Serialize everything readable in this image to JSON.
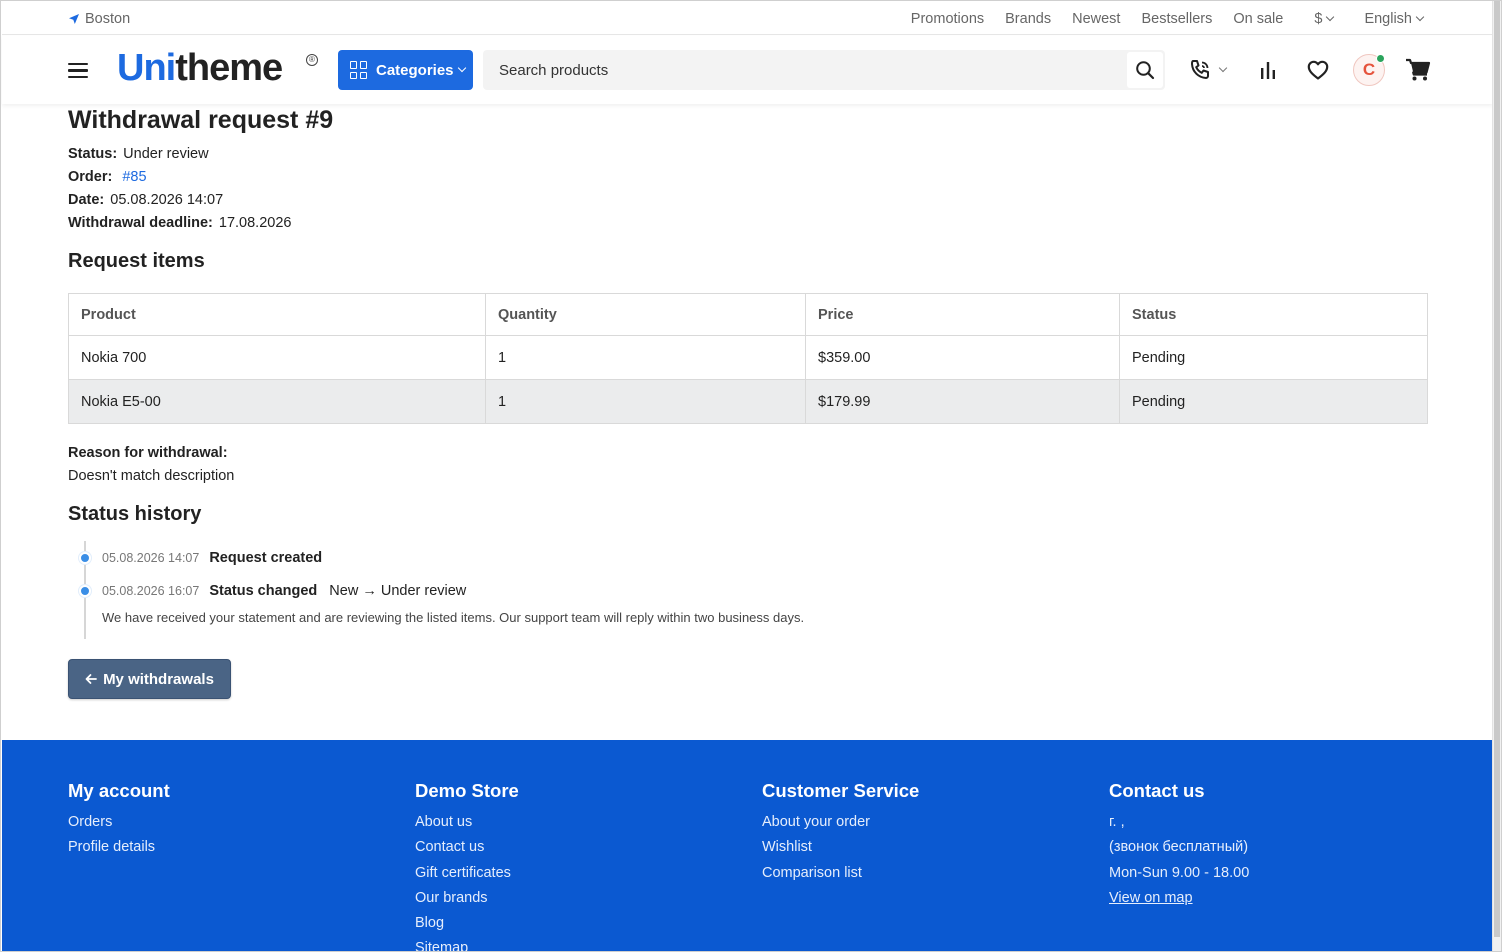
{
  "topbar": {
    "location": "Boston",
    "nav": [
      "Promotions",
      "Brands",
      "Newest",
      "Bestsellers",
      "On sale"
    ],
    "currency": "$",
    "language": "English"
  },
  "header": {
    "logo_part1": "Uni",
    "logo_part2": "theme",
    "logo_mark": "®",
    "categories_label": "Categories",
    "search_placeholder": "Search products",
    "avatar_initial": "C"
  },
  "request": {
    "title": "Withdrawal request #9",
    "status_label": "Status:",
    "status_value": "Under review",
    "order_label": "Order:",
    "order_value": "#85",
    "date_label": "Date:",
    "date_value": "05.08.2026 14:07",
    "deadline_label": "Withdrawal deadline:",
    "deadline_value": "17.08.2026"
  },
  "items": {
    "heading": "Request items",
    "columns": [
      "Product",
      "Quantity",
      "Price",
      "Status"
    ],
    "rows": [
      [
        "Nokia 700",
        "1",
        "$359.00",
        "Pending"
      ],
      [
        "Nokia E5-00",
        "1",
        "$179.99",
        "Pending"
      ]
    ]
  },
  "reason": {
    "label": "Reason for withdrawal:",
    "text": "Doesn't match description"
  },
  "history": {
    "heading": "Status history",
    "entries": [
      {
        "date": "05.08.2026 14:07",
        "event": "Request created",
        "change": ""
      },
      {
        "date": "05.08.2026 16:07",
        "event": "Status changed",
        "change": "New → Under review"
      }
    ],
    "comment": "We have received your statement and are reviewing the listed items. Our support team will reply within two business days."
  },
  "back_button": {
    "label": "My withdrawals"
  },
  "footer": {
    "columns": [
      {
        "title": "My account",
        "links": [
          "Orders",
          "Profile details"
        ]
      },
      {
        "title": "Demo Store",
        "links": [
          "About us",
          "Contact us",
          "Gift certificates",
          "Our brands",
          "Blog",
          "Sitemap"
        ]
      },
      {
        "title": "Customer Service",
        "links": [
          "About your order",
          "Wishlist",
          "Comparison list"
        ]
      },
      {
        "title": "Contact us",
        "links": [
          "г. ,",
          "(звонок бесплатный)",
          "Mon-Sun 9.00 - 18.00",
          "View on map"
        ]
      }
    ]
  },
  "colors": {
    "brand_blue": "#1d6ae0",
    "footer_blue": "#0b59d1",
    "back_button": "#4a6485",
    "timeline_dot": "#3a8ee6",
    "avatar_red": "#e5533c",
    "online_green": "#2aa45c"
  }
}
